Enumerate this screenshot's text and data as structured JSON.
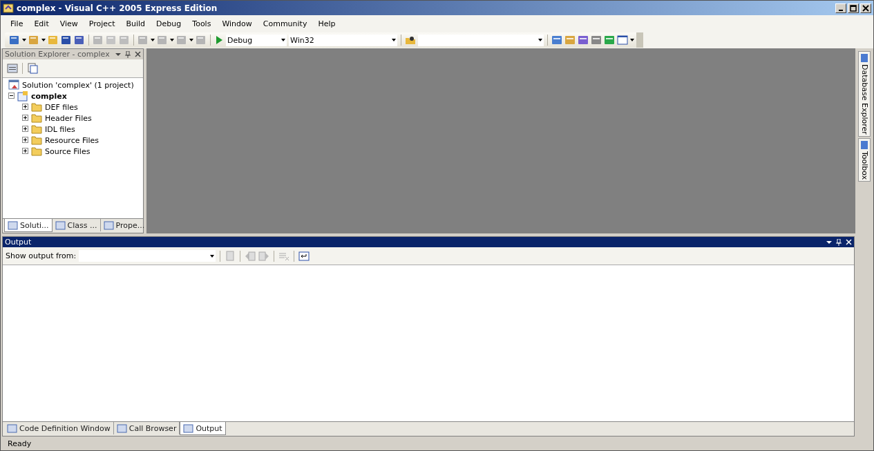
{
  "window": {
    "title": "complex - Visual C++ 2005 Express Edition"
  },
  "menu": [
    "File",
    "Edit",
    "View",
    "Project",
    "Build",
    "Debug",
    "Tools",
    "Window",
    "Community",
    "Help"
  ],
  "toolbar": {
    "configuration": "Debug",
    "platform": "Win32"
  },
  "solution_explorer": {
    "title": "Solution Explorer - complex",
    "tree": [
      {
        "label": "Solution 'complex' (1 project)",
        "children": [
          {
            "label": "complex",
            "expanded": true,
            "children": [
              {
                "label": "DEF files",
                "expanded": false
              },
              {
                "label": "Header Files",
                "expanded": false
              },
              {
                "label": "IDL files",
                "expanded": false
              },
              {
                "label": "Resource Files",
                "expanded": false
              },
              {
                "label": "Source Files",
                "expanded": false
              }
            ]
          }
        ]
      }
    ],
    "tabs": [
      {
        "label": "Soluti...",
        "selected": true
      },
      {
        "label": "Class ...",
        "selected": false
      },
      {
        "label": "Prope...",
        "selected": false
      }
    ]
  },
  "side_tabs": [
    "Database Explorer",
    "Toolbox"
  ],
  "output": {
    "title": "Output",
    "show_from_label": "Show output from:"
  },
  "bottom_tabs": [
    {
      "label": "Code Definition Window",
      "selected": false
    },
    {
      "label": "Call Browser",
      "selected": false
    },
    {
      "label": "Output",
      "selected": true
    }
  ],
  "status_bar": "Ready"
}
